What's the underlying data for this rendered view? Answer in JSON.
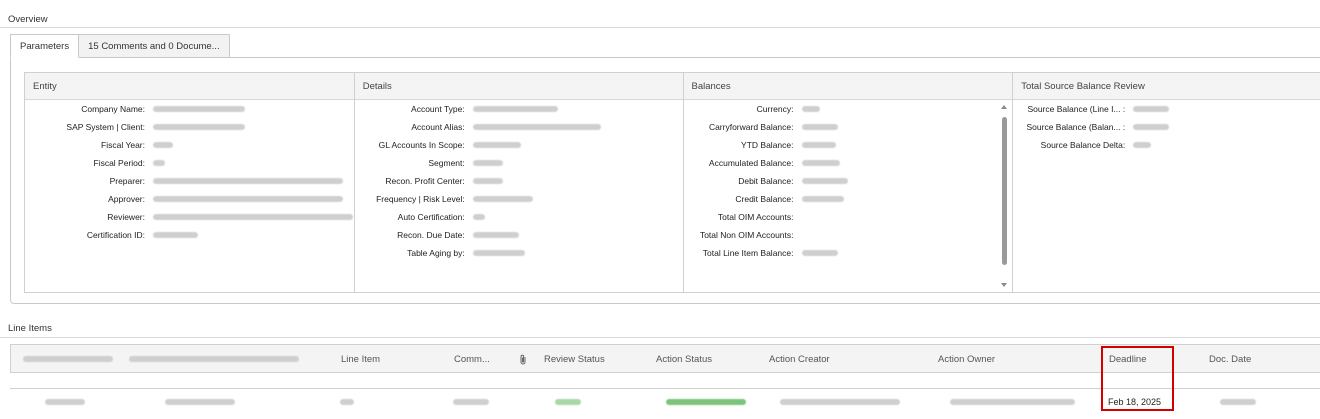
{
  "overview": {
    "title": "Overview",
    "tabs": [
      {
        "label": "Parameters",
        "active": true
      },
      {
        "label": "15 Comments and 0 Docume..."
      }
    ],
    "columns": {
      "entity": {
        "title": "Entity",
        "fields": [
          {
            "label": "Company Name:"
          },
          {
            "label": "SAP System | Client:"
          },
          {
            "label": "Fiscal Year:"
          },
          {
            "label": "Fiscal Period:"
          },
          {
            "label": "Preparer:"
          },
          {
            "label": "Approver:"
          },
          {
            "label": "Reviewer:"
          },
          {
            "label": "Certification ID:"
          }
        ]
      },
      "details": {
        "title": "Details",
        "fields": [
          {
            "label": "Account Type:"
          },
          {
            "label": "Account Alias:"
          },
          {
            "label": "GL Accounts In Scope:"
          },
          {
            "label": "Segment:"
          },
          {
            "label": "Recon. Profit Center:"
          },
          {
            "label": "Frequency | Risk Level:"
          },
          {
            "label": "Auto Certification:"
          },
          {
            "label": "Recon. Due Date:"
          },
          {
            "label": "Table Aging by:"
          }
        ]
      },
      "balances": {
        "title": "Balances",
        "fields": [
          {
            "label": "Currency:"
          },
          {
            "label": "Carryforward Balance:"
          },
          {
            "label": "YTD Balance:"
          },
          {
            "label": "Accumulated Balance:"
          },
          {
            "label": "Debit Balance:"
          },
          {
            "label": "Credit Balance:"
          },
          {
            "label": "Total OIM Accounts:"
          },
          {
            "label": "Total Non OIM Accounts:"
          },
          {
            "label": "Total Line Item Balance:"
          }
        ]
      },
      "review": {
        "title": "Total Source Balance Review",
        "fields": [
          {
            "label": "Source Balance (Line I... :"
          },
          {
            "label": "Source Balance (Balan... :"
          },
          {
            "label": "Source Balance Delta:"
          }
        ]
      }
    }
  },
  "line_items": {
    "title": "Line Items",
    "headers": {
      "line_item": "Line Item",
      "comments": "Comm...",
      "attachment_icon": "paperclip-icon",
      "review_status": "Review Status",
      "action_status": "Action Status",
      "action_creator": "Action Creator",
      "action_owner": "Action Owner",
      "deadline": "Deadline",
      "doc_date": "Doc. Date"
    },
    "row": {
      "deadline": "Feb 18, 2025"
    }
  },
  "colors": {
    "highlight_border": "#d40000",
    "review_status_blur": "#a8d8a8",
    "action_status_blur": "#7cc47c"
  }
}
